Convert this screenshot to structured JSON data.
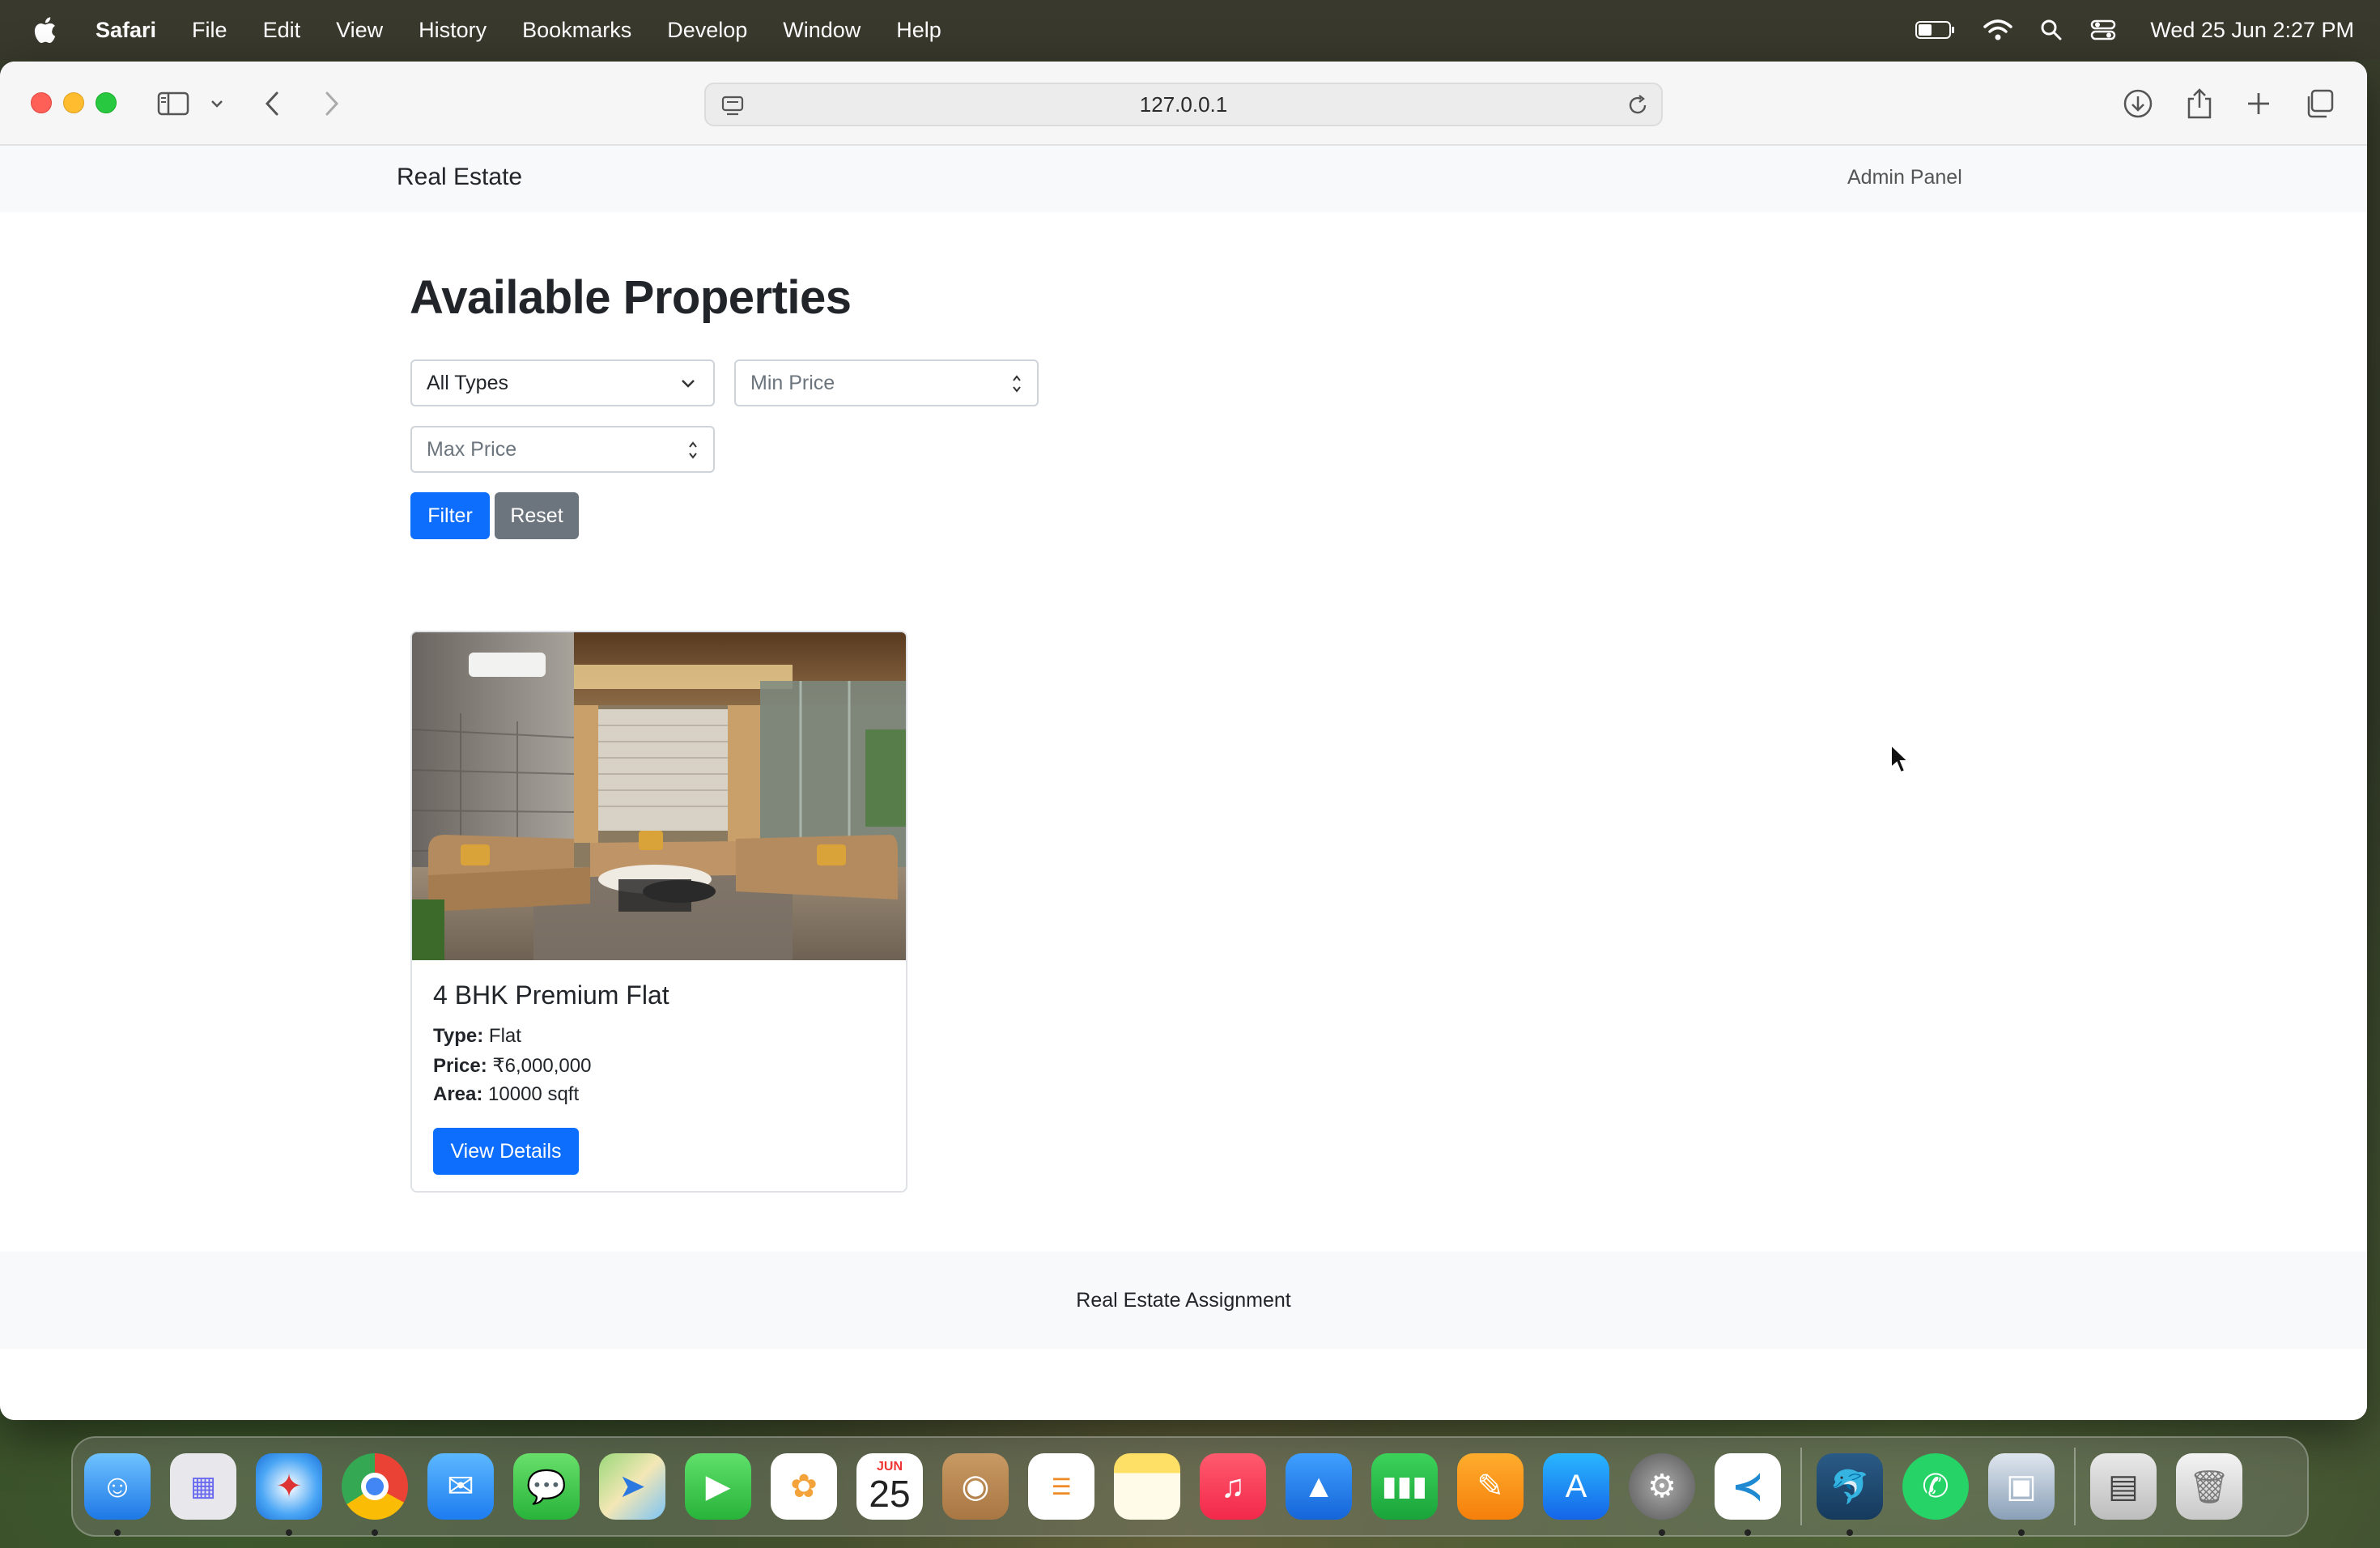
{
  "menubar": {
    "app_name": "Safari",
    "items": [
      "File",
      "Edit",
      "View",
      "History",
      "Bookmarks",
      "Develop",
      "Window",
      "Help"
    ],
    "clock": "Wed 25 Jun  2:27 PM"
  },
  "browser": {
    "url": "127.0.0.1"
  },
  "site": {
    "brand": "Real Estate",
    "nav_link": "Admin Panel",
    "heading": "Available Properties",
    "filters": {
      "type_select_value": "All Types",
      "min_price_placeholder": "Min Price",
      "max_price_placeholder": "Max Price",
      "filter_label": "Filter",
      "reset_label": "Reset"
    },
    "properties": [
      {
        "title": "4 BHK Premium Flat",
        "type_label": "Type:",
        "type": "Flat",
        "price_label": "Price:",
        "price": "₹6,000,000",
        "area_label": "Area:",
        "area": "10000 sqft",
        "button": "View Details"
      }
    ],
    "footer": "Real Estate Assignment"
  },
  "dock": {
    "calendar_month": "JUN",
    "calendar_day": "25",
    "apps": [
      "Finder",
      "Launchpad",
      "Safari",
      "Chrome",
      "Mail",
      "Messages",
      "Maps",
      "FaceTime",
      "Photos",
      "Calendar",
      "Contacts",
      "Reminders",
      "Notes",
      "Music",
      "Keynote",
      "Numbers",
      "Pages",
      "App Store",
      "System Settings",
      "VS Code",
      "MySQL Workbench",
      "WhatsApp",
      "Preview",
      "Screenshot",
      "Trash"
    ]
  },
  "colors": {
    "primary": "#0d6efd",
    "secondary": "#6c757d",
    "navbar_bg": "#f8f9fa"
  }
}
